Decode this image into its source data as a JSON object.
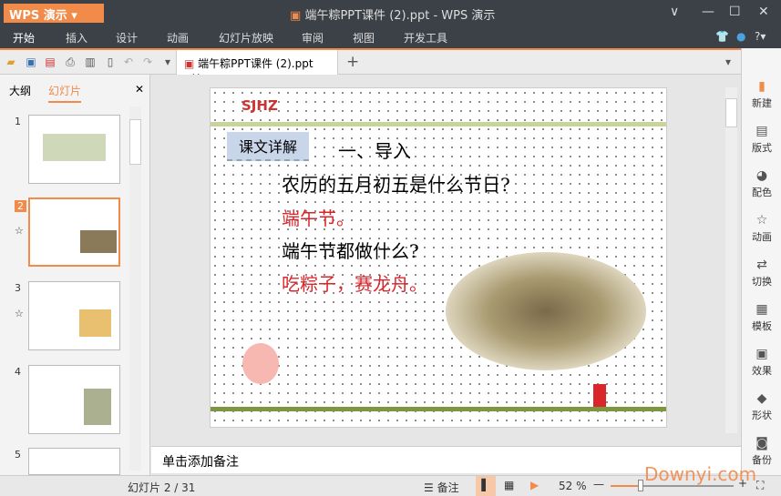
{
  "app": {
    "button": "WPS 演示",
    "title": "端午粽PPT课件 (2).ppt - WPS 演示"
  },
  "menu": [
    "开始",
    "插入",
    "设计",
    "动画",
    "幻灯片放映",
    "审阅",
    "视图",
    "开发工具"
  ],
  "doc_tab": "端午粽PPT课件 (2).ppt",
  "left_tabs": {
    "outline": "大纲",
    "slides": "幻灯片"
  },
  "thumbs": [
    {
      "n": "1"
    },
    {
      "n": "2"
    },
    {
      "n": "3"
    },
    {
      "n": "4"
    },
    {
      "n": "5"
    }
  ],
  "slide": {
    "logo": "SJHZ",
    "tag": "课文详解",
    "heading": "一、导入",
    "q1": "农历的五月初五是什么节日?",
    "a1": "端午节。",
    "q2": "端午节都做什么?",
    "a2": "吃粽子，赛龙舟。"
  },
  "notes_placeholder": "单击添加备注",
  "right": [
    "新建",
    "版式",
    "配色",
    "动画",
    "切换",
    "模板",
    "效果",
    "形状",
    "备份"
  ],
  "status": {
    "slide": "幻灯片 2 / 31",
    "notes": "备注",
    "zoom": "52 %",
    "watermark": "Downyi.com"
  },
  "colors": {
    "accent": "#f28a4a",
    "red": "#d9262b"
  }
}
